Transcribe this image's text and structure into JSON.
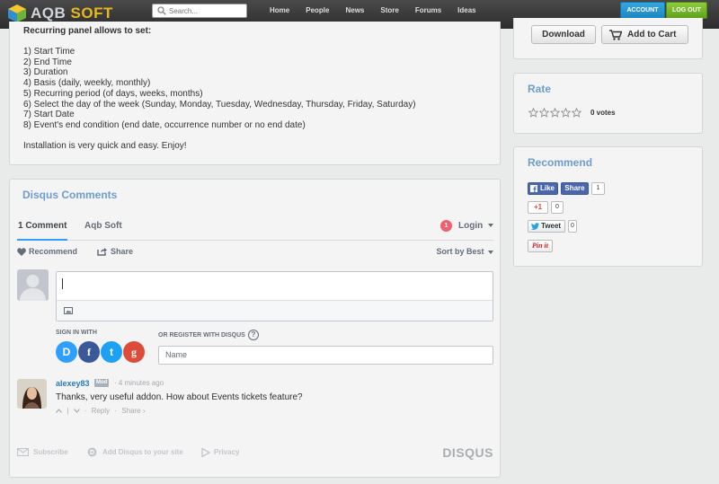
{
  "header": {
    "logo_part1": "AQB",
    "logo_part2": "SOFT",
    "search_placeholder": "Search...",
    "nav": [
      "Home",
      "People",
      "News",
      "Store",
      "Forums",
      "Ideas"
    ],
    "account_label": "ACCOUNT",
    "logout_label": "LOG OUT"
  },
  "description": {
    "heading": "Recurring panel allows to set:",
    "items": [
      "1) Start Time",
      "2) End Time",
      "3) Duration",
      "4) Basis (daily, weekly, monthly)",
      "5) Recurring period (of days, weeks, months)",
      "6) Select the day of the week (Sunday, Monday, Tuesday, Wednesday, Thursday, Friday, Saturday)",
      "7) Start Date",
      "8) Event's end condition (end date, occurrence number or no end date)"
    ],
    "footer": "Installation is very quick and easy. Enjoy!"
  },
  "purchase": {
    "download_label": "Download",
    "cart_label": "Add to Cart"
  },
  "rate": {
    "title": "Rate",
    "votes": "0 votes",
    "rating": 0,
    "max": 5
  },
  "recommend": {
    "title": "Recommend",
    "fb_like": "Like",
    "fb_share": "Share",
    "fb_count": "1",
    "gplus": "+1",
    "gplus_count": "0",
    "tweet": "Tweet",
    "tweet_count": "0",
    "pinit": "Pin it"
  },
  "disqus": {
    "title": "Disqus Comments",
    "tab_comments": "1 Comment",
    "tab_site": "Aqb Soft",
    "login_badge": "1",
    "login_label": "Login",
    "recommend_label": "Recommend",
    "share_label": "Share",
    "sort_label": "Sort by Best",
    "sign_in_label": "SIGN IN WITH",
    "or_register_label": "OR REGISTER WITH DISQUS",
    "name_placeholder": "Name",
    "social": [
      "D",
      "f",
      "t",
      "g"
    ],
    "comment": {
      "author": "alexey83",
      "badge": "Mod",
      "time": "4 minutes ago",
      "text": "Thanks, very useful addon. How about Events tickets feature?",
      "reply": "Reply",
      "share": "Share"
    },
    "footer": {
      "subscribe": "Subscribe",
      "add": "Add Disqus to your site",
      "privacy": "Privacy",
      "brand": "DISQUS"
    }
  },
  "colors": {
    "accent_blue": "#6d9ccd",
    "disqus_blue": "#2e9fff",
    "account_btn": "#1c86c3",
    "logout_btn": "#5ea11a",
    "logo_gold": "#e8b81c"
  }
}
